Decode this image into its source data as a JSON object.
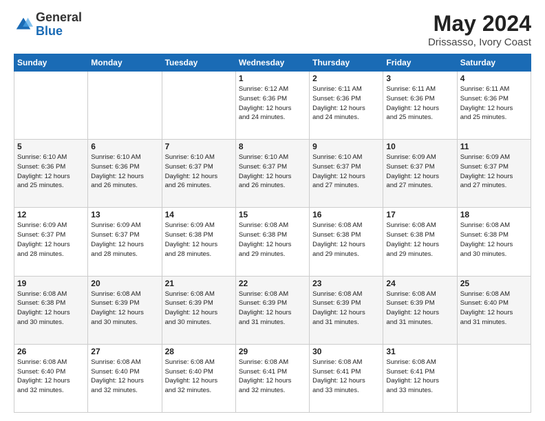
{
  "logo": {
    "general": "General",
    "blue": "Blue"
  },
  "title": {
    "month_year": "May 2024",
    "location": "Drissasso, Ivory Coast"
  },
  "headers": [
    "Sunday",
    "Monday",
    "Tuesday",
    "Wednesday",
    "Thursday",
    "Friday",
    "Saturday"
  ],
  "weeks": [
    [
      {
        "num": "",
        "info": ""
      },
      {
        "num": "",
        "info": ""
      },
      {
        "num": "",
        "info": ""
      },
      {
        "num": "1",
        "info": "Sunrise: 6:12 AM\nSunset: 6:36 PM\nDaylight: 12 hours\nand 24 minutes."
      },
      {
        "num": "2",
        "info": "Sunrise: 6:11 AM\nSunset: 6:36 PM\nDaylight: 12 hours\nand 24 minutes."
      },
      {
        "num": "3",
        "info": "Sunrise: 6:11 AM\nSunset: 6:36 PM\nDaylight: 12 hours\nand 25 minutes."
      },
      {
        "num": "4",
        "info": "Sunrise: 6:11 AM\nSunset: 6:36 PM\nDaylight: 12 hours\nand 25 minutes."
      }
    ],
    [
      {
        "num": "5",
        "info": "Sunrise: 6:10 AM\nSunset: 6:36 PM\nDaylight: 12 hours\nand 25 minutes."
      },
      {
        "num": "6",
        "info": "Sunrise: 6:10 AM\nSunset: 6:36 PM\nDaylight: 12 hours\nand 26 minutes."
      },
      {
        "num": "7",
        "info": "Sunrise: 6:10 AM\nSunset: 6:37 PM\nDaylight: 12 hours\nand 26 minutes."
      },
      {
        "num": "8",
        "info": "Sunrise: 6:10 AM\nSunset: 6:37 PM\nDaylight: 12 hours\nand 26 minutes."
      },
      {
        "num": "9",
        "info": "Sunrise: 6:10 AM\nSunset: 6:37 PM\nDaylight: 12 hours\nand 27 minutes."
      },
      {
        "num": "10",
        "info": "Sunrise: 6:09 AM\nSunset: 6:37 PM\nDaylight: 12 hours\nand 27 minutes."
      },
      {
        "num": "11",
        "info": "Sunrise: 6:09 AM\nSunset: 6:37 PM\nDaylight: 12 hours\nand 27 minutes."
      }
    ],
    [
      {
        "num": "12",
        "info": "Sunrise: 6:09 AM\nSunset: 6:37 PM\nDaylight: 12 hours\nand 28 minutes."
      },
      {
        "num": "13",
        "info": "Sunrise: 6:09 AM\nSunset: 6:37 PM\nDaylight: 12 hours\nand 28 minutes."
      },
      {
        "num": "14",
        "info": "Sunrise: 6:09 AM\nSunset: 6:38 PM\nDaylight: 12 hours\nand 28 minutes."
      },
      {
        "num": "15",
        "info": "Sunrise: 6:08 AM\nSunset: 6:38 PM\nDaylight: 12 hours\nand 29 minutes."
      },
      {
        "num": "16",
        "info": "Sunrise: 6:08 AM\nSunset: 6:38 PM\nDaylight: 12 hours\nand 29 minutes."
      },
      {
        "num": "17",
        "info": "Sunrise: 6:08 AM\nSunset: 6:38 PM\nDaylight: 12 hours\nand 29 minutes."
      },
      {
        "num": "18",
        "info": "Sunrise: 6:08 AM\nSunset: 6:38 PM\nDaylight: 12 hours\nand 30 minutes."
      }
    ],
    [
      {
        "num": "19",
        "info": "Sunrise: 6:08 AM\nSunset: 6:38 PM\nDaylight: 12 hours\nand 30 minutes."
      },
      {
        "num": "20",
        "info": "Sunrise: 6:08 AM\nSunset: 6:39 PM\nDaylight: 12 hours\nand 30 minutes."
      },
      {
        "num": "21",
        "info": "Sunrise: 6:08 AM\nSunset: 6:39 PM\nDaylight: 12 hours\nand 30 minutes."
      },
      {
        "num": "22",
        "info": "Sunrise: 6:08 AM\nSunset: 6:39 PM\nDaylight: 12 hours\nand 31 minutes."
      },
      {
        "num": "23",
        "info": "Sunrise: 6:08 AM\nSunset: 6:39 PM\nDaylight: 12 hours\nand 31 minutes."
      },
      {
        "num": "24",
        "info": "Sunrise: 6:08 AM\nSunset: 6:39 PM\nDaylight: 12 hours\nand 31 minutes."
      },
      {
        "num": "25",
        "info": "Sunrise: 6:08 AM\nSunset: 6:40 PM\nDaylight: 12 hours\nand 31 minutes."
      }
    ],
    [
      {
        "num": "26",
        "info": "Sunrise: 6:08 AM\nSunset: 6:40 PM\nDaylight: 12 hours\nand 32 minutes."
      },
      {
        "num": "27",
        "info": "Sunrise: 6:08 AM\nSunset: 6:40 PM\nDaylight: 12 hours\nand 32 minutes."
      },
      {
        "num": "28",
        "info": "Sunrise: 6:08 AM\nSunset: 6:40 PM\nDaylight: 12 hours\nand 32 minutes."
      },
      {
        "num": "29",
        "info": "Sunrise: 6:08 AM\nSunset: 6:41 PM\nDaylight: 12 hours\nand 32 minutes."
      },
      {
        "num": "30",
        "info": "Sunrise: 6:08 AM\nSunset: 6:41 PM\nDaylight: 12 hours\nand 33 minutes."
      },
      {
        "num": "31",
        "info": "Sunrise: 6:08 AM\nSunset: 6:41 PM\nDaylight: 12 hours\nand 33 minutes."
      },
      {
        "num": "",
        "info": ""
      }
    ]
  ]
}
